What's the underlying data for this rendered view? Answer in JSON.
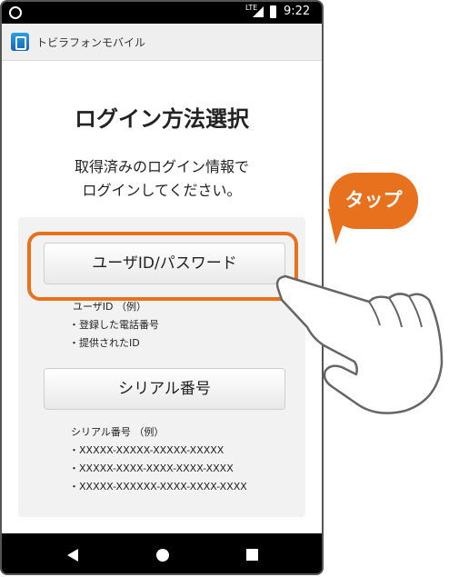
{
  "status_bar": {
    "network": "LTE",
    "time": "9:22"
  },
  "app_bar": {
    "title": "トビラフォンモバイル"
  },
  "main": {
    "heading": "ログイン方法選択",
    "description_line1": "取得済みのログイン情報で",
    "description_line2": "ログインしてください。",
    "userid_button": "ユーザID/パスワード",
    "userid_example_title": "ユーザID （例）",
    "userid_examples": [
      "・登録した電話番号",
      "・提供されたID"
    ],
    "serial_button": "シリアル番号",
    "serial_example_title": "シリアル番号 （例）",
    "serial_examples": [
      "・XXXXX-XXXXX-XXXXX-XXXXX",
      "・XXXXX-XXXX-XXXX-XXXX-XXXX",
      "・XXXXX-XXXXXX-XXXX-XXXX-XXXX"
    ]
  },
  "callout": {
    "label": "タップ",
    "color": "#e8711e"
  },
  "icons": [
    "app-icon",
    "nav-back-icon",
    "nav-home-icon",
    "nav-recent-icon",
    "tap-hand-icon"
  ]
}
